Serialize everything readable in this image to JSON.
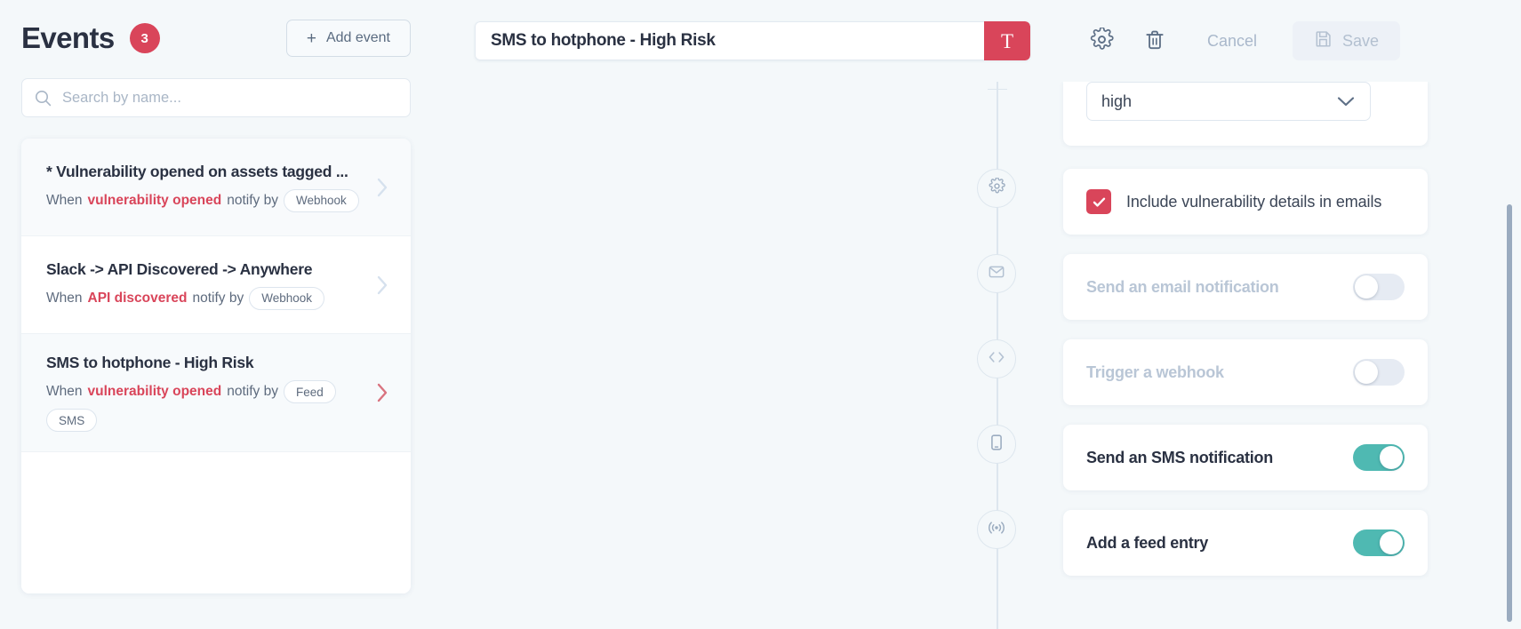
{
  "sidebar": {
    "title": "Events",
    "badge_count": "3",
    "add_event_label": "Add event",
    "search": {
      "placeholder": "Search by name...",
      "value": ""
    },
    "events": [
      {
        "name": "* Vulnerability opened on assets tagged ...",
        "when_prefix": "When",
        "trigger": "vulnerability opened",
        "notify_prefix": "notify by",
        "channels": [
          "Webhook"
        ],
        "selected": false,
        "shaded": true
      },
      {
        "name": "Slack -> API Discovered -> Anywhere",
        "when_prefix": "When",
        "trigger": "API discovered",
        "notify_prefix": "notify by",
        "channels": [
          "Webhook"
        ],
        "selected": false,
        "shaded": false
      },
      {
        "name": "SMS to hotphone - High Risk",
        "when_prefix": "When",
        "trigger": "vulnerability opened",
        "notify_prefix": "notify by",
        "channels": [
          "Feed",
          "SMS"
        ],
        "selected": true,
        "shaded": true
      }
    ]
  },
  "toolbar": {
    "title_value": "SMS to hotphone - High Risk",
    "title_placeholder": "Event name",
    "format_button_label": "T",
    "cancel_label": "Cancel",
    "save_label": "Save"
  },
  "detail": {
    "severity_select": {
      "value": "high"
    },
    "rows": [
      {
        "id": "include-details",
        "icon": "gear-icon",
        "type": "checkbox",
        "label": "Include vulnerability details in emails",
        "checked": true
      },
      {
        "id": "email-notification",
        "icon": "envelope-icon",
        "type": "toggle",
        "label": "Send an email notification",
        "enabled": false
      },
      {
        "id": "webhook",
        "icon": "code-icon",
        "type": "toggle",
        "label": "Trigger a webhook",
        "enabled": false
      },
      {
        "id": "sms-notification",
        "icon": "phone-icon",
        "type": "toggle",
        "label": "Send an SMS notification",
        "enabled": true
      },
      {
        "id": "feed-entry",
        "icon": "broadcast-icon",
        "type": "toggle",
        "label": "Add a feed entry",
        "enabled": true
      }
    ]
  },
  "colors": {
    "accent_red": "#d9455a",
    "toggle_on": "#4fb9b2",
    "text_dark": "#2a3142",
    "text_muted": "#b9c6d6",
    "page_bg": "#f4f8fa"
  }
}
